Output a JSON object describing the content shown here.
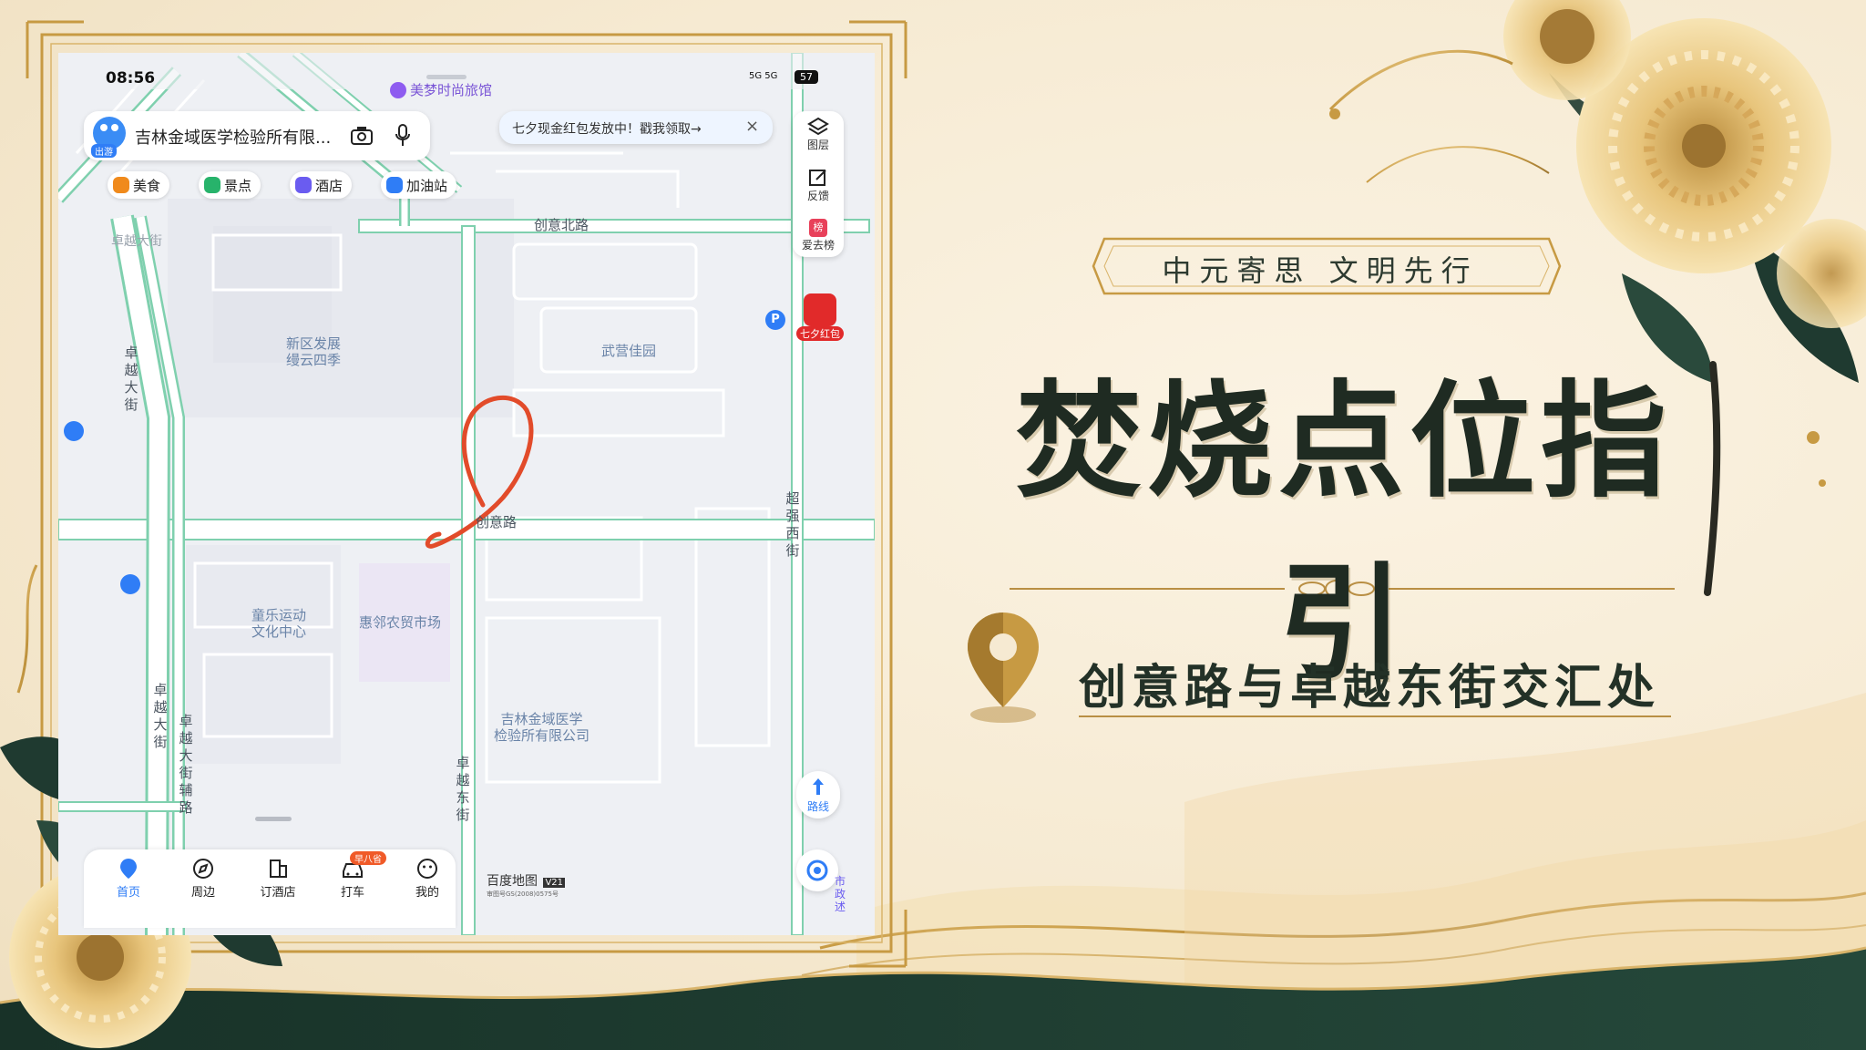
{
  "status_bar": {
    "time": "08:56",
    "network": "5G 5G",
    "battery": "57"
  },
  "map_app": {
    "search": {
      "text": "吉林金域医学检验所有限...",
      "mascot_tag": "出游"
    },
    "banner": {
      "text": "七夕现金红包发放中！戳我领取→",
      "close": "×"
    },
    "top_poi": "美梦时尚旅馆",
    "categories": [
      {
        "label": "美食",
        "color": "#f08a1c"
      },
      {
        "label": "景点",
        "color": "#27b36b"
      },
      {
        "label": "酒店",
        "color": "#6a5cf0"
      },
      {
        "label": "加油站",
        "color": "#2f7df6"
      }
    ],
    "right_tools": [
      {
        "label": "图层"
      },
      {
        "label": "反馈"
      },
      {
        "label": "爱去榜"
      }
    ],
    "red_packet_label": "七夕红包",
    "route_label": "路线",
    "parking": "P",
    "map_labels": {
      "poi_xinqu": "新区发展\n缦云四季",
      "poi_wuying": "武营佳园",
      "poi_tongle": "童乐运动\n文化中心",
      "poi_huilin": "惠邻农贸市场",
      "poi_jilin": "吉林金域医学\n检验所有限公司"
    },
    "roads": {
      "chuangyi_north": "创意北路",
      "chuangyi": "创意路",
      "zhuoyue_top": "卓越大街",
      "zhuoyue_left": "卓越大街",
      "zhuoyue_left2": "卓越大街",
      "zhuoyue_aux": "卓越大街辅路",
      "zhuoyue_east": "卓越东街",
      "chaoqiang_west": "超强西街"
    },
    "map_logo": "百度地图",
    "map_logo_badge": "V21",
    "map_copyright": "审图号GS(2008)0575号",
    "corner_label": "市政述",
    "bottom_nav": [
      {
        "label": "首页",
        "active": true
      },
      {
        "label": "周边"
      },
      {
        "label": "订酒店"
      },
      {
        "label": "打车",
        "badge": "早八省"
      },
      {
        "label": "我的"
      }
    ]
  },
  "poster": {
    "slogan": "中元寄思  文明先行",
    "title": "焚烧点位指引",
    "location": "创意路与卓越东街交汇处",
    "colors": {
      "gold": "#c79a43",
      "dark_green": "#1f3a30",
      "ink": "#1f2b22",
      "marker": "#e24b2a"
    }
  }
}
